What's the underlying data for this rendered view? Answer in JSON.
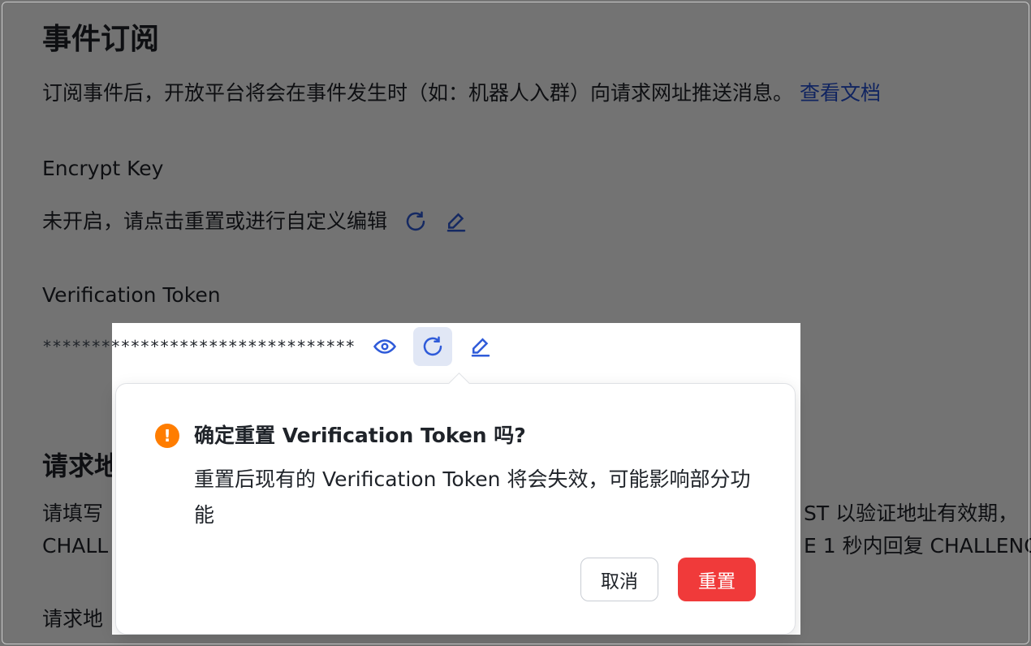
{
  "page": {
    "title": "事件订阅",
    "description": "订阅事件后，开放平台将会在事件发生时（如：机器人入群）向请求网址推送消息。",
    "doc_link": "查看文档"
  },
  "encrypt_key": {
    "label": "Encrypt Key",
    "status": "未开启，请点击重置或进行自定义编辑"
  },
  "verification_token": {
    "label": "Verification Token",
    "masked_value": "********************************"
  },
  "request_url": {
    "section_title_partial": "请求地",
    "desc_line1_left": "请填写",
    "desc_line1_right": "ST 以验证地址有效期，",
    "desc_line2_left": "CHALL",
    "desc_line2_right": "E 1 秒内回复 CHALLENG",
    "field_label_partial": "请求地"
  },
  "popconfirm": {
    "title": "确定重置 Verification Token 吗?",
    "body": "重置后现有的 Verification Token 将会失效，可能影响部分功能",
    "cancel_label": "取消",
    "confirm_label": "重置"
  },
  "icons": {
    "refresh": "refresh-icon",
    "edit": "edit-icon",
    "eye": "eye-icon",
    "warning": "warning-icon"
  },
  "colors": {
    "link": "#2450d6",
    "icon_blue": "#2f5bd9",
    "warning": "#ff7d00",
    "danger": "#f03a3a"
  }
}
